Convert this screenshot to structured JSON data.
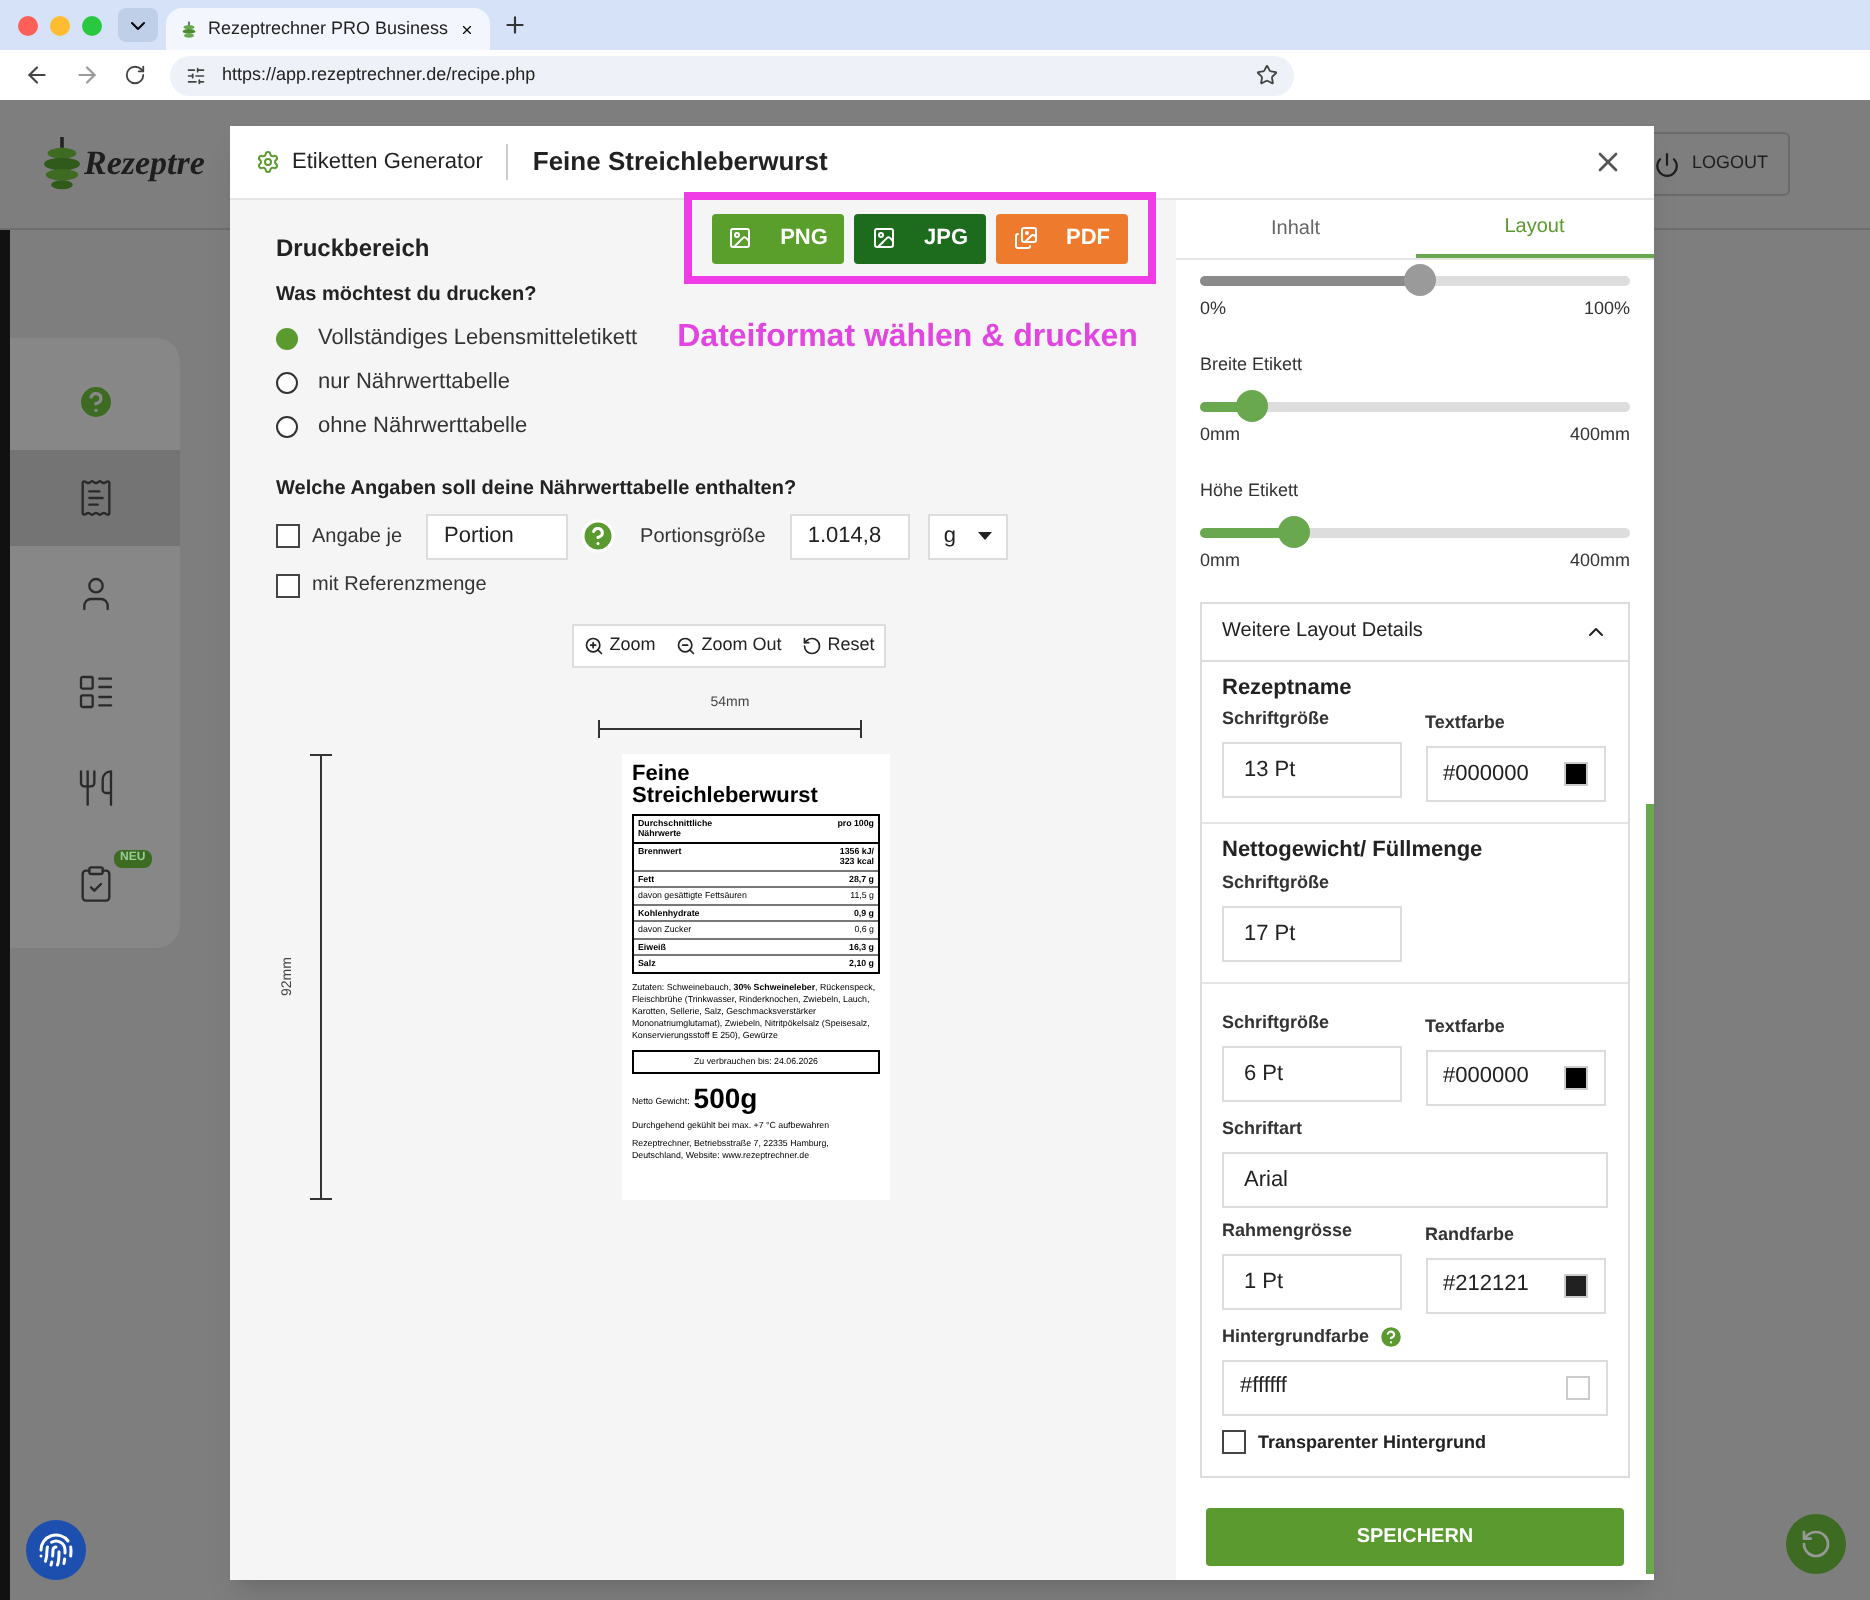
{
  "browser": {
    "tab_title": "Rezeptrechner PRO Business",
    "url": "https://app.rezeptrechner.de/recipe.php"
  },
  "app": {
    "logo_text": "Rezeptre",
    "logout": "LOGOUT",
    "sidebar": [
      {
        "kind": "help",
        "selected": false
      },
      {
        "kind": "recipe",
        "selected": true
      },
      {
        "kind": "user",
        "selected": false
      },
      {
        "kind": "checklist",
        "selected": false
      },
      {
        "kind": "dining",
        "selected": false
      },
      {
        "kind": "clipboard",
        "selected": false,
        "badge": "NEU"
      }
    ]
  },
  "modal": {
    "header_label": "Etiketten Generator",
    "title": "Feine Streichleberwurst",
    "left": {
      "section_title": "Druckbereich",
      "export_buttons": [
        {
          "kind": "png",
          "label": "PNG"
        },
        {
          "kind": "jpg",
          "label": "JPG"
        },
        {
          "kind": "pdf",
          "label": "PDF"
        }
      ],
      "annotation": "Dateiformat wählen & drucken",
      "question": "Was möchtest du drucken?",
      "print_options": [
        {
          "label": "Vollständiges Lebensmitteletikett",
          "selected": true
        },
        {
          "label": "nur Nährwerttabelle",
          "selected": false
        },
        {
          "label": "ohne Nährwerttabelle",
          "selected": false
        }
      ],
      "table_question": "Welche Angaben soll deine Nährwerttabelle enthalten?",
      "per": {
        "label": "Angabe je",
        "checked": false,
        "value": "Portion"
      },
      "portion_label": "Portionsgröße",
      "portion_value": "1.014,8",
      "unit": "g",
      "reference": {
        "label": "mit Referenzmenge",
        "checked": false
      },
      "zoom_buttons": [
        {
          "kind": "zoom_in",
          "label": "Zoom"
        },
        {
          "kind": "zoom_out",
          "label": "Zoom Out"
        },
        {
          "kind": "reset",
          "label": "Reset"
        }
      ],
      "preview": {
        "width_label": "54mm",
        "height_label": "92mm",
        "name": "Feine Streichleberwurst",
        "table_rows": [
          {
            "label": "Durchschnittliche Nährwerte",
            "value": "pro 100g",
            "bold": true
          },
          {
            "label": "Brennwert",
            "value": "1356 kJ/ 323 kcal",
            "bold": true
          },
          {
            "label": "Fett",
            "value": "28,7 g",
            "bold": true
          },
          {
            "label": "davon gesättigte Fettsäuren",
            "value": "11,5 g",
            "bold": false
          },
          {
            "label": "Kohlenhydrate",
            "value": "0,9 g",
            "bold": true
          },
          {
            "label": "davon Zucker",
            "value": "0,6 g",
            "bold": false
          },
          {
            "label": "Eiweiß",
            "value": "16,3 g",
            "bold": true
          },
          {
            "label": "Salz",
            "value": "2,10 g",
            "bold": true
          }
        ],
        "ingredients": "Zutaten: Schweinebauch, **30% Schweineleber**, Rückenspeck, Fleischbrühe (Trinkwasser, Rinderknochen, Zwiebeln, Lauch, Karotten, Sellerie, Salz, Geschmacksverstärker Mononatriumglutamat), Zwiebeln, Nitritpökelsalz (Speisesalz, Konservierungsstoff E 250), Gewürze",
        "best_before": "Zu verbrauchen bis: 24.06.2026",
        "net_label": "Netto Gewicht:",
        "net_value": "500g",
        "storage": "Durchgehend gekühlt bei max. +7 °C aufbewahren",
        "address": "Rezeptrechner, Betriebsstraße 7, 22335 Hamburg, Deutschland, Website: www.rezeptrechner.de"
      }
    },
    "right": {
      "tabs": [
        {
          "label": "Inhalt",
          "selected": false
        },
        {
          "label": "Layout",
          "selected": true
        }
      ],
      "sliders": [
        {
          "kind": "neutral",
          "level": 0.51,
          "min": "0%",
          "max": "100%"
        },
        {
          "kind": "accent",
          "label": "Breite Etikett",
          "level": 0.12,
          "min": "0mm",
          "max": "400mm"
        },
        {
          "kind": "accent",
          "label": "Höhe Etikett",
          "level": 0.22,
          "min": "0mm",
          "max": "400mm"
        }
      ],
      "details": {
        "title": "Weitere Layout Details",
        "expanded": true,
        "sections": [
          {
            "title": "Rezeptname",
            "rows": [
              [
                {
                  "kind": "text",
                  "label": "Schriftgröße",
                  "value": "13 Pt"
                },
                {
                  "kind": "color",
                  "label": "Textfarbe",
                  "value": "#000000",
                  "color": "#000000"
                }
              ]
            ]
          },
          {
            "title": "Nettogewicht/ Füllmenge",
            "rows": [
              [
                {
                  "kind": "text",
                  "label": "Schriftgröße",
                  "value": "17 Pt"
                }
              ]
            ]
          },
          {
            "rows": [
              [
                {
                  "kind": "text",
                  "label": "Schriftgröße",
                  "value": "6 Pt"
                },
                {
                  "kind": "color",
                  "label": "Textfarbe",
                  "value": "#000000",
                  "color": "#000000"
                }
              ],
              [
                {
                  "kind": "wide_text",
                  "label": "Schriftart",
                  "value": "Arial"
                }
              ],
              [
                {
                  "kind": "text",
                  "label": "Rahmengrösse",
                  "value": "1 Pt"
                },
                {
                  "kind": "color",
                  "label": "Randfarbe",
                  "value": "#212121",
                  "color": "#212121"
                }
              ],
              [
                {
                  "kind": "wide_color",
                  "label": "Hintergrundfarbe",
                  "help": true,
                  "value": "#ffffff",
                  "color": "#ffffff"
                }
              ]
            ],
            "checkbox": {
              "label": "Transparenter Hintergrund",
              "checked": false
            }
          }
        ]
      },
      "save": "SPEICHERN"
    }
  }
}
